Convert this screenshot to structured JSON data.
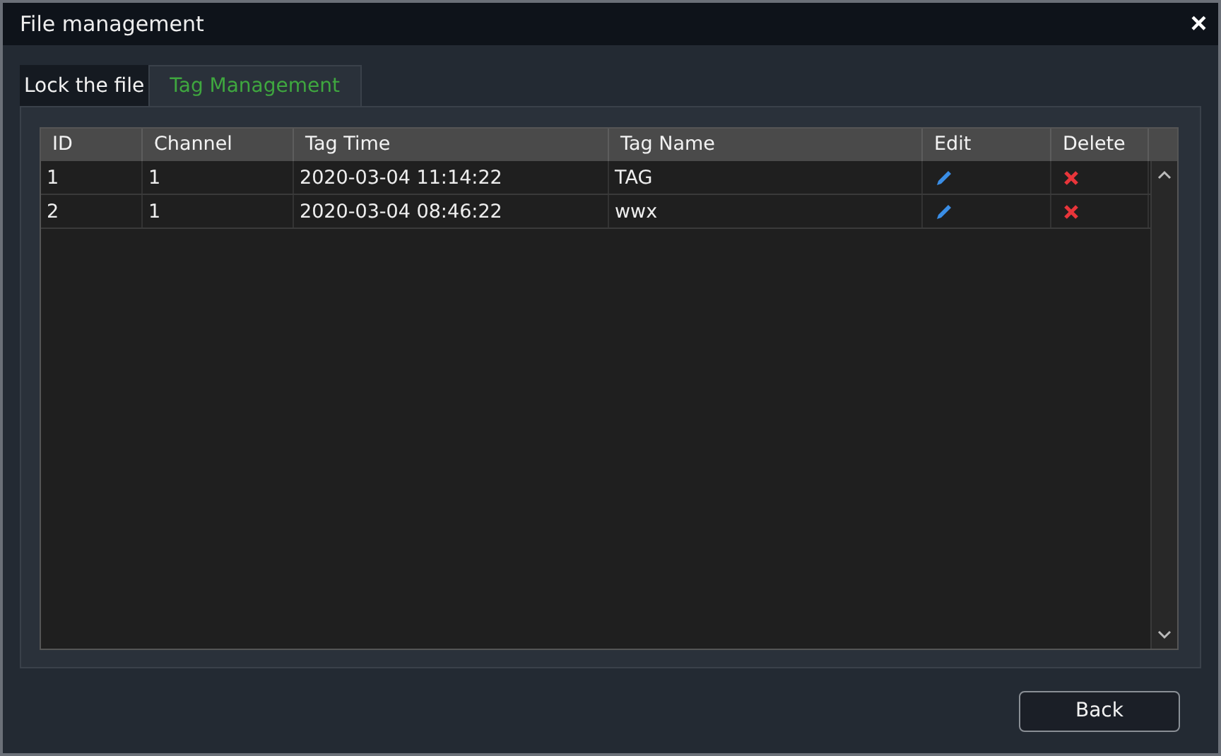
{
  "window": {
    "title": "File management",
    "close": "×"
  },
  "tabs": [
    {
      "label": "Lock the file",
      "selected": false
    },
    {
      "label": "Tag Management",
      "selected": true
    }
  ],
  "table": {
    "columns": [
      "ID",
      "Channel",
      "Tag Time",
      "Tag Name",
      "Edit",
      "Delete"
    ],
    "rows": [
      {
        "id": "1",
        "channel": "1",
        "tag_time": "2020-03-04 11:14:22",
        "tag_name": "TAG"
      },
      {
        "id": "2",
        "channel": "1",
        "tag_time": "2020-03-04 08:46:22",
        "tag_name": "wwx"
      }
    ]
  },
  "buttons": [
    "Back"
  ]
}
